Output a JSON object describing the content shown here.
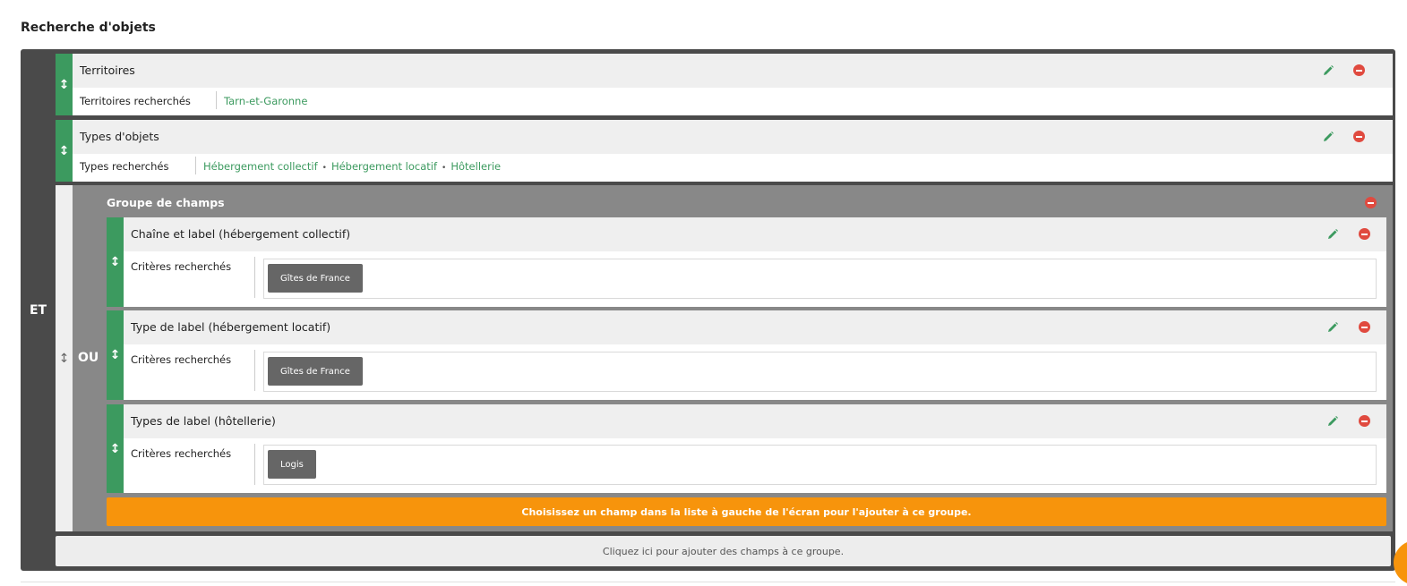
{
  "page_title": "Recherche d'objets",
  "root_operator": "ET",
  "blocks": [
    {
      "title": "Territoires",
      "field_label": "Territoires recherchés",
      "values": [
        "Tarn-et-Garonne"
      ]
    },
    {
      "title": "Types d'objets",
      "field_label": "Types recherchés",
      "values": [
        "Hébergement collectif",
        "Hébergement locatif",
        "Hôtellerie"
      ],
      "separator": "•"
    }
  ],
  "group": {
    "title": "Groupe de champs",
    "operator": "OU",
    "items": [
      {
        "title": "Chaîne et label (hébergement collectif)",
        "field_label": "Critères recherchés",
        "chip": "Gîtes de France"
      },
      {
        "title": "Type de label (hébergement locatif)",
        "field_label": "Critères recherchés",
        "chip": "Gîtes de France"
      },
      {
        "title": "Types de label (hôtellerie)",
        "field_label": "Critères recherchés",
        "chip": "Logis"
      }
    ],
    "hint": "Choisissez un champ dans la liste à gauche de l'écran pour l'ajouter à ce groupe."
  },
  "add_fields_label": "Cliquez ici pour ajouter des champs à ce groupe.",
  "icons": {
    "drag": "drag-handle-icon",
    "edit": "pencil-icon",
    "remove": "minus-circle-icon"
  },
  "colors": {
    "green": "#3c9a5f",
    "dark": "#4a4a4a",
    "group_bg": "#888888",
    "orange": "#f7940c",
    "remove_red": "#e04a3f"
  }
}
